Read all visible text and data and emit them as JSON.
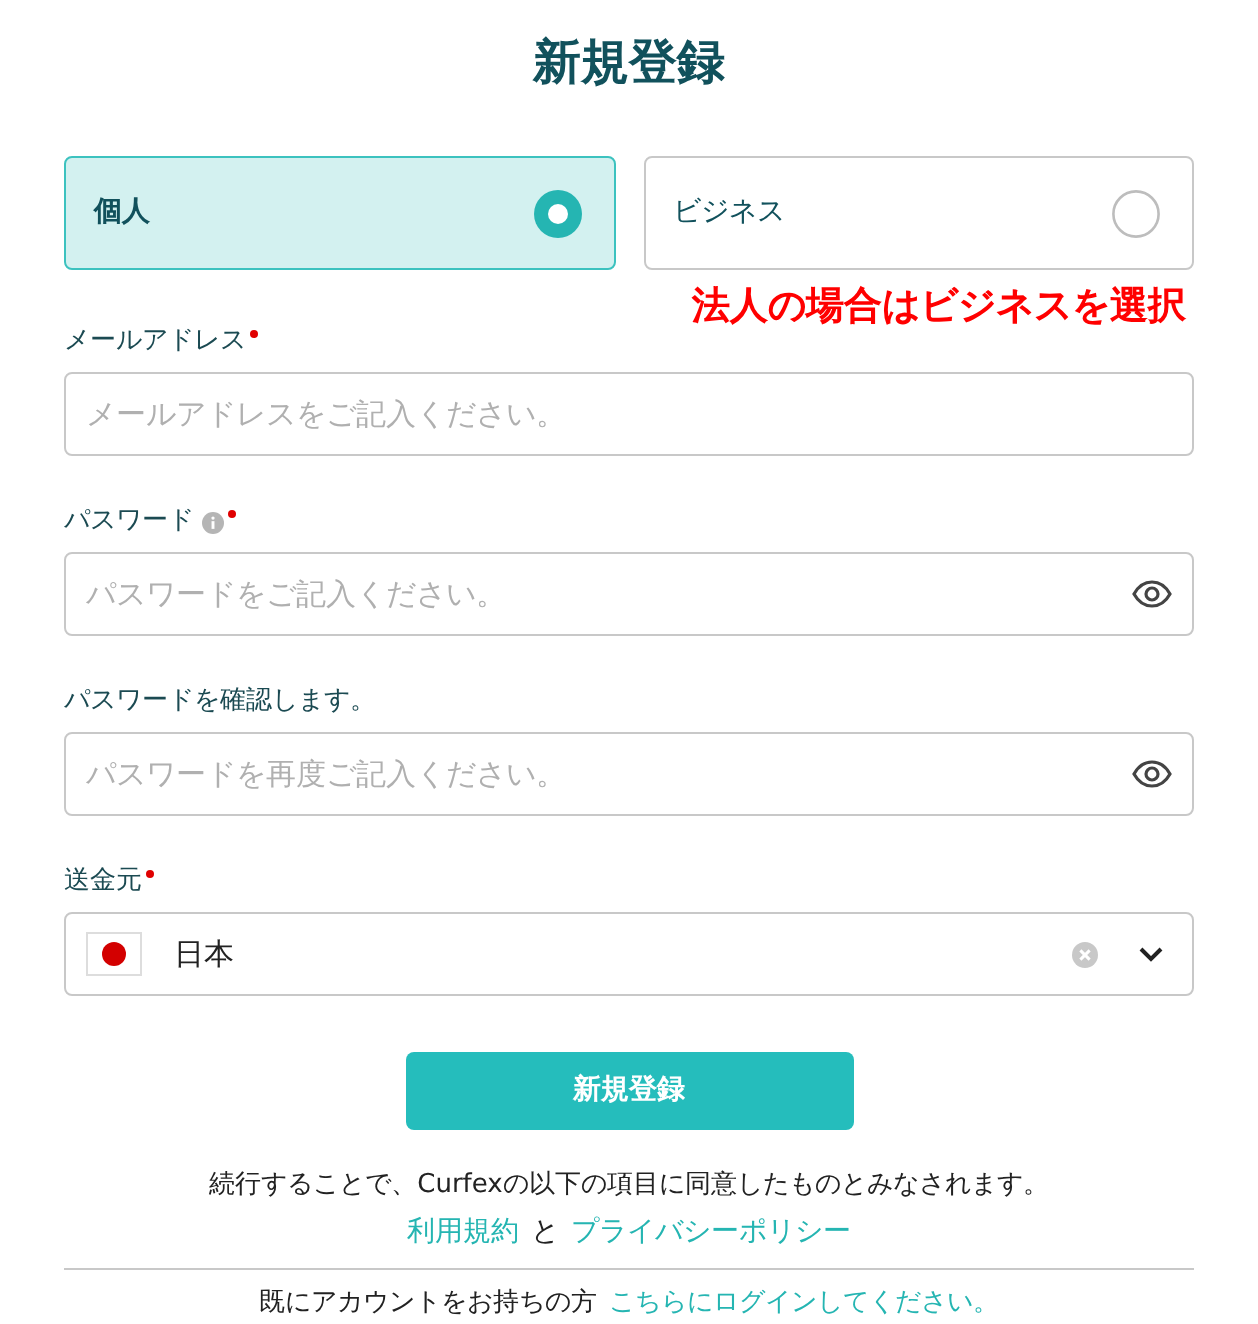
{
  "title": "新規登録",
  "account_types": [
    {
      "label": "個人",
      "selected": true
    },
    {
      "label": "ビジネス",
      "selected": false
    }
  ],
  "annotation": "法人の場合はビジネスを選択",
  "fields": [
    {
      "kind": "text",
      "label": "メールアドレス",
      "required": true,
      "info": false,
      "placeholder": "メールアドレスをご記入ください。"
    },
    {
      "kind": "password",
      "label": "パスワード",
      "required": true,
      "info": true,
      "placeholder": "パスワードをご記入ください。"
    },
    {
      "kind": "password",
      "label": "パスワードを確認します。",
      "required": false,
      "info": false,
      "placeholder": "パスワードを再度ご記入ください。"
    },
    {
      "kind": "select",
      "label": "送金元",
      "required": true,
      "info": false,
      "value": "日本"
    }
  ],
  "submit": "新規登録",
  "consent": {
    "text": "続行することで、Curfexの以下の項目に同意したものとみなされます。",
    "terms_link": "利用規約",
    "conjunction": "と",
    "privacy_link": "プライバシーポリシー"
  },
  "login": {
    "text": "既にアカウントをお持ちの方",
    "link": "こちらにログインしてください。"
  }
}
